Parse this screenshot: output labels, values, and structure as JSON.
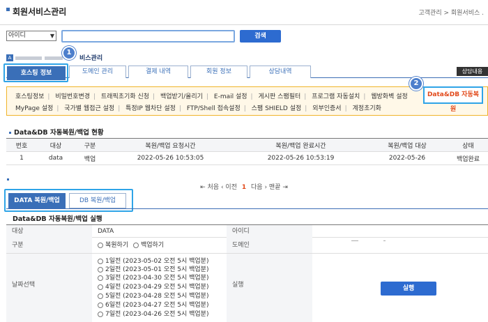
{
  "header": {
    "title": "회원서비스관리",
    "breadcrumb": "고객관리 > 회원서비스 ."
  },
  "search": {
    "select_value": "아이디",
    "input_value": "",
    "button_label": "검색"
  },
  "site": {
    "badge": "A",
    "name_suffix": "비스관리"
  },
  "callouts": {
    "one": "1",
    "two": "2"
  },
  "tabs": [
    {
      "label": "호스팅 정보",
      "active": true
    },
    {
      "label": "도메인 관리"
    },
    {
      "label": "결제 내역"
    },
    {
      "label": "회원 정보"
    },
    {
      "label": "상담내역"
    }
  ],
  "consult_button": "상담내용",
  "menu": {
    "row1": [
      "호스팅정보",
      "비밀번호변경",
      "트래픽초기화 신청",
      "백업받기/올리기",
      "E-mail 설정",
      "게시판 스팸필터",
      "프로그램 자동설치",
      "웹방화벽 설정"
    ],
    "row2": [
      "MyPage 설정",
      "국가별 웹접근 설정",
      "특정IP 웹차단 설정",
      "FTP/Shell 접속설정",
      "스팸 SHIELD 설정",
      "외부인증서",
      "계정초기화"
    ],
    "highlight": "Data&DB 자동복원"
  },
  "history": {
    "title": "Data&DB 자동복원/백업 현황",
    "columns": [
      "번호",
      "대상",
      "구분",
      "복원/백업 요청시간",
      "복원/백업 완료시간",
      "복원/백업 대상",
      "상태"
    ],
    "rows": [
      [
        "1",
        "data",
        "백업",
        "2022-05-26 10:53:05",
        "2022-05-26 10:53:19",
        "2022-05-26",
        "백업완료"
      ]
    ]
  },
  "pager": {
    "first": "처음",
    "prev": "이전",
    "current": "1",
    "next": "다음",
    "last": "맨끝"
  },
  "data_tabs": [
    {
      "label": "DATA 복원/백업",
      "active": true
    },
    {
      "label": "DB 복원/백업"
    }
  ],
  "form": {
    "title": "Data&DB 자동복원/백업 실행",
    "target_label": "대상",
    "target_value": "DATA",
    "id_label": "아이디",
    "kind_label": "구분",
    "kind_options": [
      "복원하기",
      "백업하기"
    ],
    "domain_label": "도메인",
    "date_label": "날짜선택",
    "date_options": [
      "1일전 (2023-05-02 오전 5시 백업분)",
      "2일전 (2023-05-01 오전 5시 백업분)",
      "3일전 (2023-04-30 오전 5시 백업분)",
      "4일전 (2023-04-29 오전 5시 백업분)",
      "5일전 (2023-04-28 오전 5시 백업분)",
      "6일전 (2023-04-27 오전 5시 백업분)",
      "7일전 (2023-04-26 오전 5시 백업분)"
    ],
    "run_label": "실행",
    "run_button": "실행"
  }
}
